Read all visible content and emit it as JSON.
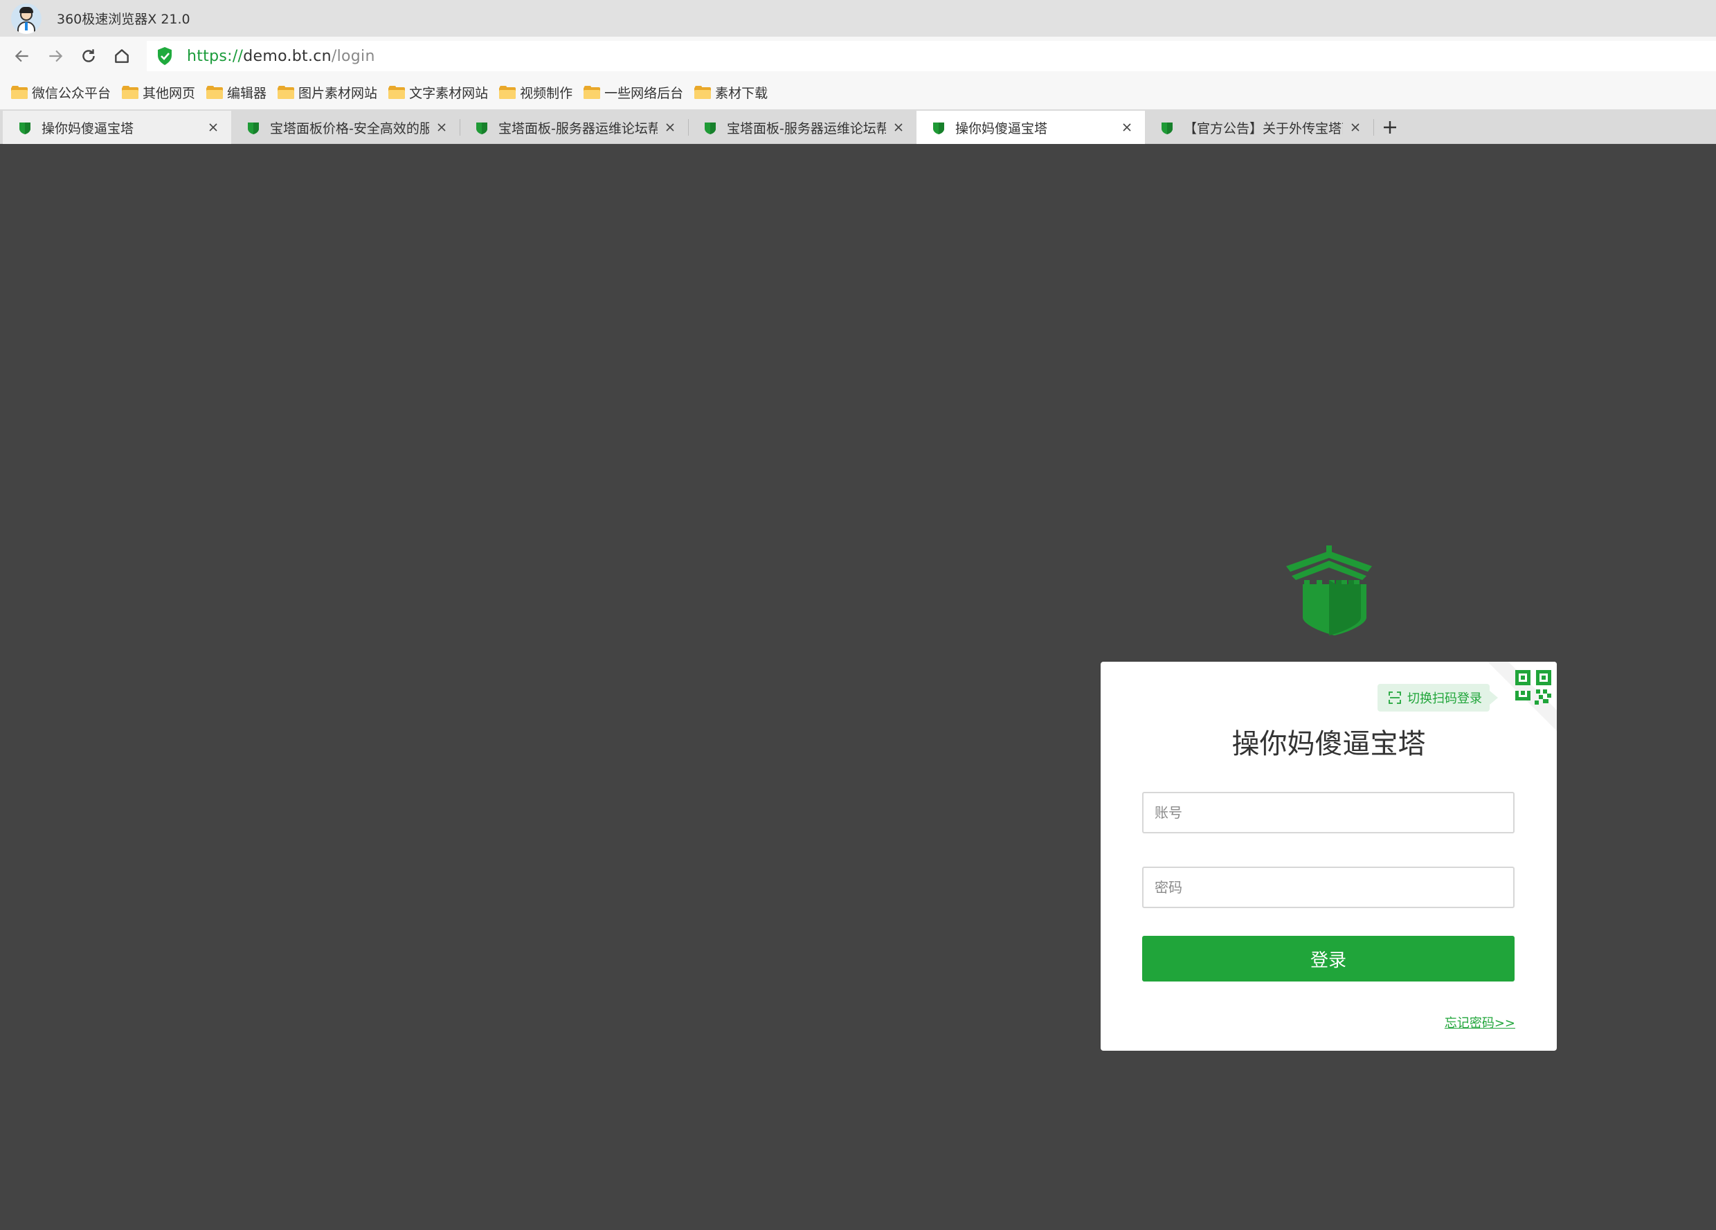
{
  "window": {
    "title": "360极速浏览器X 21.0"
  },
  "address": {
    "scheme": "https://",
    "host": "demo.bt.cn",
    "path": "/login"
  },
  "bookmarks": [
    "微信公众平台",
    "其他网页",
    "编辑器",
    "图片素材网站",
    "文字素材网站",
    "视频制作",
    "一些网络后台",
    "素材下载"
  ],
  "tabs": [
    {
      "label": "操你妈傻逼宝塔"
    },
    {
      "label": "宝塔面板价格-安全高效的服务器"
    },
    {
      "label": "宝塔面板-服务器运维论坛帮你"
    },
    {
      "label": "宝塔面板-服务器运维论坛帮你"
    },
    {
      "label": "操你妈傻逼宝塔"
    },
    {
      "label": "【官方公告】关于外传宝塔面板"
    }
  ],
  "login": {
    "qr_switch": "切换扫码登录",
    "title": "操你妈傻逼宝塔",
    "username_placeholder": "账号",
    "password_placeholder": "密码",
    "submit": "登录",
    "forgot": "忘记密码>>"
  },
  "colors": {
    "accent": "#20a53a",
    "background": "#444444"
  },
  "icons": {
    "nav": [
      "back-arrow-icon",
      "forward-arrow-icon",
      "reload-icon",
      "home-icon"
    ],
    "security": "shield-check-icon",
    "logo": "bt-castle-logo-icon",
    "qr": "qr-code-icon"
  }
}
